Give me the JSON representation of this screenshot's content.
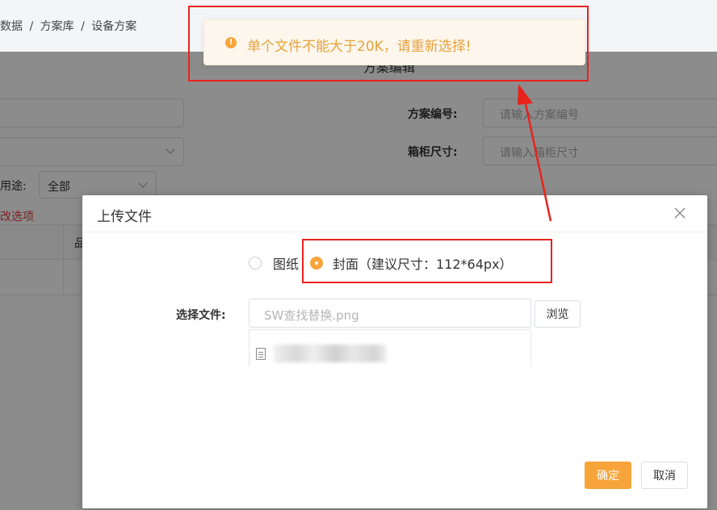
{
  "breadcrumb": [
    "数据",
    "方案库",
    "设备方案"
  ],
  "background": {
    "form_title": "方案编辑",
    "scheme_no_label": "方案编号:",
    "scheme_no_placeholder": "请输入方案编号",
    "cabinet_size_label": "箱柜尺寸:",
    "cabinet_size_placeholder": "请输入箱柜尺寸",
    "usage_label": "用途:",
    "usage_value": "全部",
    "red_text": "改选项",
    "table_header_cell": "品"
  },
  "dialog": {
    "title": "上传文件",
    "radio_options": [
      {
        "label": "图纸",
        "checked": false
      },
      {
        "label": "封面（建议尺寸：112*64px）",
        "checked": true
      }
    ],
    "file_label": "选择文件:",
    "file_value": "SW查找替换.png",
    "browse_label": "浏览",
    "ok_label": "确定",
    "cancel_label": "取消"
  },
  "toast": {
    "icon": "warning-icon",
    "message": "单个文件不能大于20K，请重新选择!"
  },
  "colors": {
    "accent": "#f7a43a",
    "toast_text": "#e6a23c",
    "toast_bg": "#fdf6ec",
    "annotation_red": "#e8231d"
  }
}
